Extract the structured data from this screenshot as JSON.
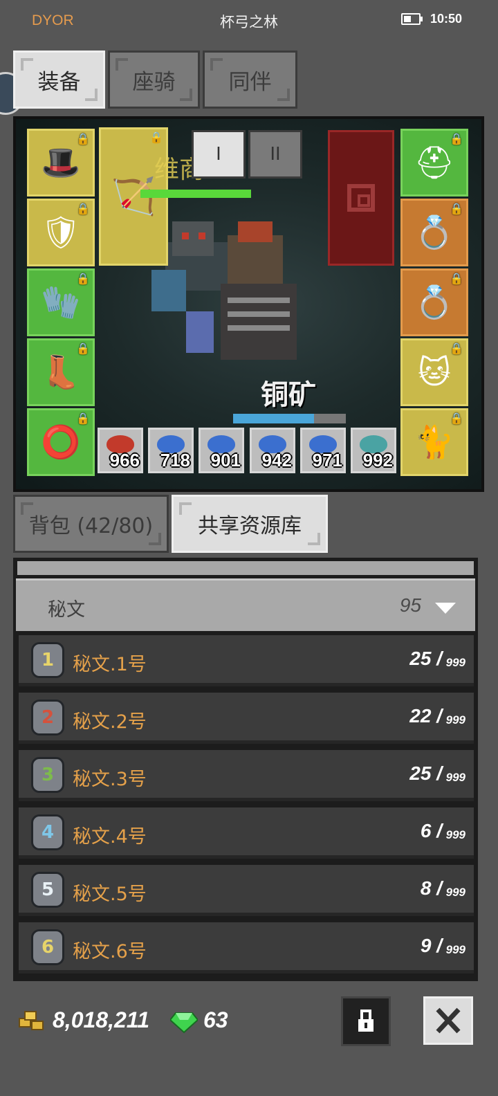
{
  "status_bar": {
    "left_text": "DYOR",
    "title": "杯弓之林",
    "time": "10:50"
  },
  "top_tabs": [
    {
      "label": "装备",
      "active": true
    },
    {
      "label": "座骑",
      "active": false
    },
    {
      "label": "同伴",
      "active": false
    }
  ],
  "scene": {
    "enemy_name_partial": "维商",
    "mob_name": "铜矿",
    "mob_health_fraction": 0.72,
    "player_health_fraction": 1.0,
    "roman_tabs": [
      {
        "label": "I",
        "active": true
      },
      {
        "label": "II",
        "active": false
      }
    ],
    "left_equipment": [
      {
        "icon": "crown-helmet-icon",
        "glyph": "🎩"
      },
      {
        "icon": "armor-icon",
        "glyph": "🛡"
      },
      {
        "icon": "gauntlet-icon",
        "glyph": "🧤"
      },
      {
        "icon": "boots-icon",
        "glyph": "👢"
      },
      {
        "icon": "belt-icon",
        "glyph": "⭕"
      }
    ],
    "weapon": {
      "icon": "bow-icon",
      "glyph": "🏹"
    },
    "right_equipment": [
      {
        "icon": "horned-helmet-icon",
        "glyph": "⛑"
      },
      {
        "icon": "gold-ring-icon",
        "glyph": "💍"
      },
      {
        "icon": "gold-ring-icon",
        "glyph": "💍"
      },
      {
        "icon": "companion-portrait-icon",
        "glyph": "🐱"
      },
      {
        "icon": "cat-portrait-icon",
        "glyph": "🐈"
      }
    ],
    "resource_slots": [
      {
        "icon": "red-drop-icon",
        "count": "966",
        "color": "#c23a2b"
      },
      {
        "icon": "blue-drop-icon",
        "count": "718",
        "color": "#3b6fcf"
      },
      {
        "icon": "blue-drop-icon",
        "count": "901",
        "color": "#3b6fcf"
      },
      {
        "icon": "blue-drop-icon",
        "count": "942",
        "color": "#3b6fcf"
      },
      {
        "icon": "blue-drop-icon",
        "count": "971",
        "color": "#3b6fcf"
      },
      {
        "icon": "teal-fish-icon",
        "count": "992",
        "color": "#4aa3a3"
      }
    ]
  },
  "bottom_tabs": [
    {
      "label": "背包 (42/80)",
      "active": false
    },
    {
      "label": "共享资源库",
      "active": true
    }
  ],
  "category": {
    "label": "秘文",
    "count": "95"
  },
  "items": [
    {
      "name": "秘文.1号",
      "qty": "25 /",
      "max": "999",
      "rune": "1",
      "rune_color": "#e7d46a"
    },
    {
      "name": "秘文.2号",
      "qty": "22 /",
      "max": "999",
      "rune": "2",
      "rune_color": "#d4523d"
    },
    {
      "name": "秘文.3号",
      "qty": "25 /",
      "max": "999",
      "rune": "3",
      "rune_color": "#7dbb4c"
    },
    {
      "name": "秘文.4号",
      "qty": "6 /",
      "max": "999",
      "rune": "4",
      "rune_color": "#7fc7e8"
    },
    {
      "name": "秘文.5号",
      "qty": "8 /",
      "max": "999",
      "rune": "5",
      "rune_color": "#e9f1f6"
    },
    {
      "name": "秘文.6号",
      "qty": "9 /",
      "max": "999",
      "rune": "6",
      "rune_color": "#e7d46a"
    }
  ],
  "footer": {
    "gold": "8,018,211",
    "gems": "63"
  },
  "colors": {
    "accent_orange": "#e5a14a",
    "green_slot": "#54b73f",
    "yellow_slot": "#c9b94a",
    "orange_slot": "#c67a31"
  }
}
